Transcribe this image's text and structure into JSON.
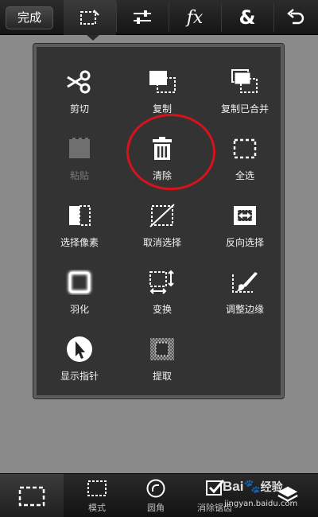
{
  "top_bar": {
    "done_label": "完成",
    "tools": [
      {
        "name": "selection-icon",
        "active": true
      },
      {
        "name": "adjust-sliders-icon"
      },
      {
        "name": "fx-icon",
        "glyph": "fx"
      },
      {
        "name": "ampersand-icon",
        "glyph": "&"
      },
      {
        "name": "undo-icon"
      }
    ]
  },
  "menu": {
    "items": [
      {
        "label": "剪切",
        "icon": "scissors-icon"
      },
      {
        "label": "复制",
        "icon": "copy-icon"
      },
      {
        "label": "复制已合并",
        "icon": "copy-merged-icon"
      },
      {
        "label": "粘贴",
        "icon": "paste-icon",
        "disabled": true
      },
      {
        "label": "清除",
        "icon": "trash-icon",
        "highlighted": true
      },
      {
        "label": "全选",
        "icon": "select-all-icon"
      },
      {
        "label": "选择像素",
        "icon": "select-pixels-icon"
      },
      {
        "label": "取消选择",
        "icon": "deselect-icon"
      },
      {
        "label": "反向选择",
        "icon": "invert-selection-icon"
      },
      {
        "label": "羽化",
        "icon": "feather-icon"
      },
      {
        "label": "变换",
        "icon": "transform-icon"
      },
      {
        "label": "调整边缘",
        "icon": "refine-edge-icon"
      },
      {
        "label": "显示指针",
        "icon": "cursor-icon"
      },
      {
        "label": "提取",
        "icon": "extract-icon"
      }
    ]
  },
  "bottom_bar": {
    "items": [
      {
        "label": "模式",
        "icon": "mode-icon"
      },
      {
        "label": "圆角",
        "icon": "rounded-corner-icon"
      },
      {
        "label": "消除锯齿",
        "icon": "anti-alias-icon"
      }
    ]
  },
  "watermark": {
    "brand": "Bai",
    "suffix": "经验",
    "url": "jingyan.baidu.com"
  },
  "colors": {
    "highlight_ring": "#d8121b",
    "panel": "#333333",
    "background": "#8a8a8a"
  }
}
